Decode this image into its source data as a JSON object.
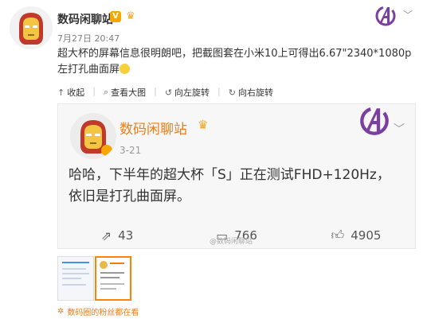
{
  "post": {
    "username": "数码闲聊站",
    "verified_badge": "V",
    "timestamp": "7月27日 20:47",
    "body_text": "超大杯的屏幕信息很明朗吧，把截图套在小米10上可得出6.67\"2340*1080p左打孔曲面屏"
  },
  "actions": {
    "collapse": "收起",
    "view_large": "查看大图",
    "rotate_left": "向左旋转",
    "rotate_right": "向右旋转"
  },
  "card": {
    "username": "数码闲聊站",
    "time": "3-21",
    "text": "哈哈，下半年的超大杯「S」正在测试FHD+120Hz，依旧是打孔曲面屏。",
    "repost_count": "43",
    "comment_count": "766",
    "like_count": "4905",
    "watermark": "@数码闲聊站"
  },
  "footer": {
    "fans_text": "数码圈的粉丝都在看"
  },
  "icons": {
    "avatar": "iron-man-avatar-icon",
    "logo": "avengers-logo-icon",
    "more": "chevron-down-icon",
    "repost": "repost-icon",
    "comment": "comment-icon",
    "like": "thumbs-up-icon"
  },
  "colors": {
    "accent": "#ee7d17",
    "badge": "#f7a700",
    "avengers": "#7b3fa0"
  }
}
